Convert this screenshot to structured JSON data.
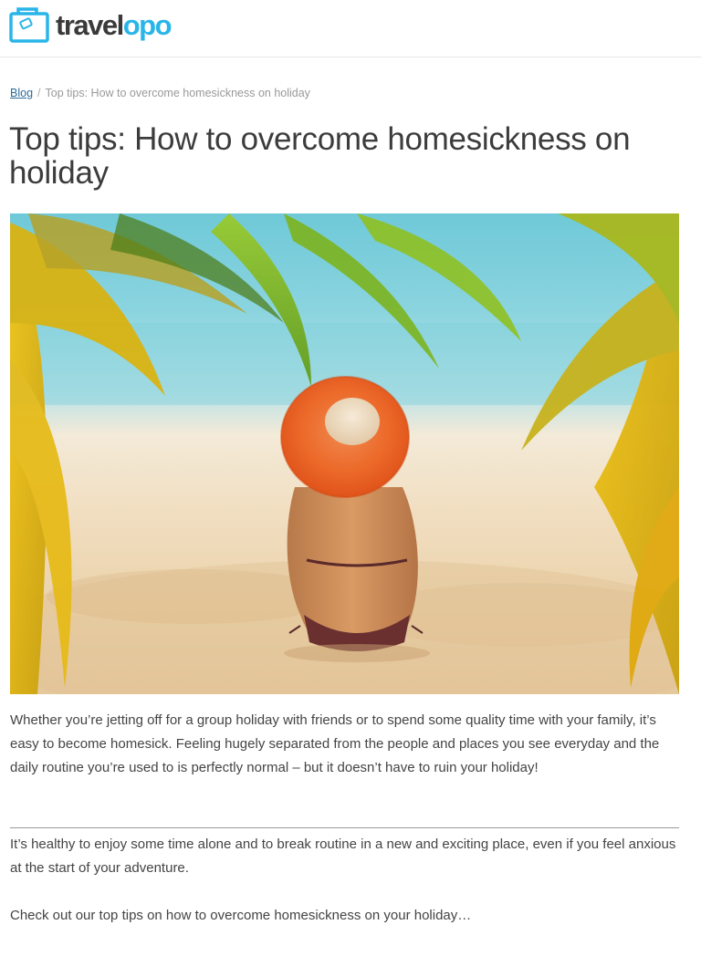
{
  "header": {
    "logo": {
      "text_part1": "travel",
      "text_part2": "opo",
      "icon": "suitcase-icon"
    }
  },
  "breadcrumb": {
    "home_label": "Blog",
    "separator": "/",
    "current": "Top tips: How to overcome homesickness on holiday"
  },
  "article": {
    "title": "Top tips: How to overcome homesickness on holiday",
    "hero_image": "woman-in-orange-sun-hat-on-beach-under-palm-leaves",
    "paragraphs": [
      "Whether you’re jetting off for a group holiday with friends or to spend some quality time with your family, it’s easy to become homesick. Feeling hugely separated from the people and places you see everyday and the daily routine you’re used to is perfectly normal – but it doesn’t have to ruin your holiday!",
      "It’s healthy to enjoy some time alone and to break routine in a new and exciting place, even if you feel anxious at the start of your adventure.",
      "Check out our top tips on how to overcome homesickness on your holiday…"
    ]
  },
  "colors": {
    "brand_dark": "#3a3a3a",
    "brand_accent": "#29b5e8",
    "link": "#2b6a9b",
    "body_text": "#444444"
  }
}
